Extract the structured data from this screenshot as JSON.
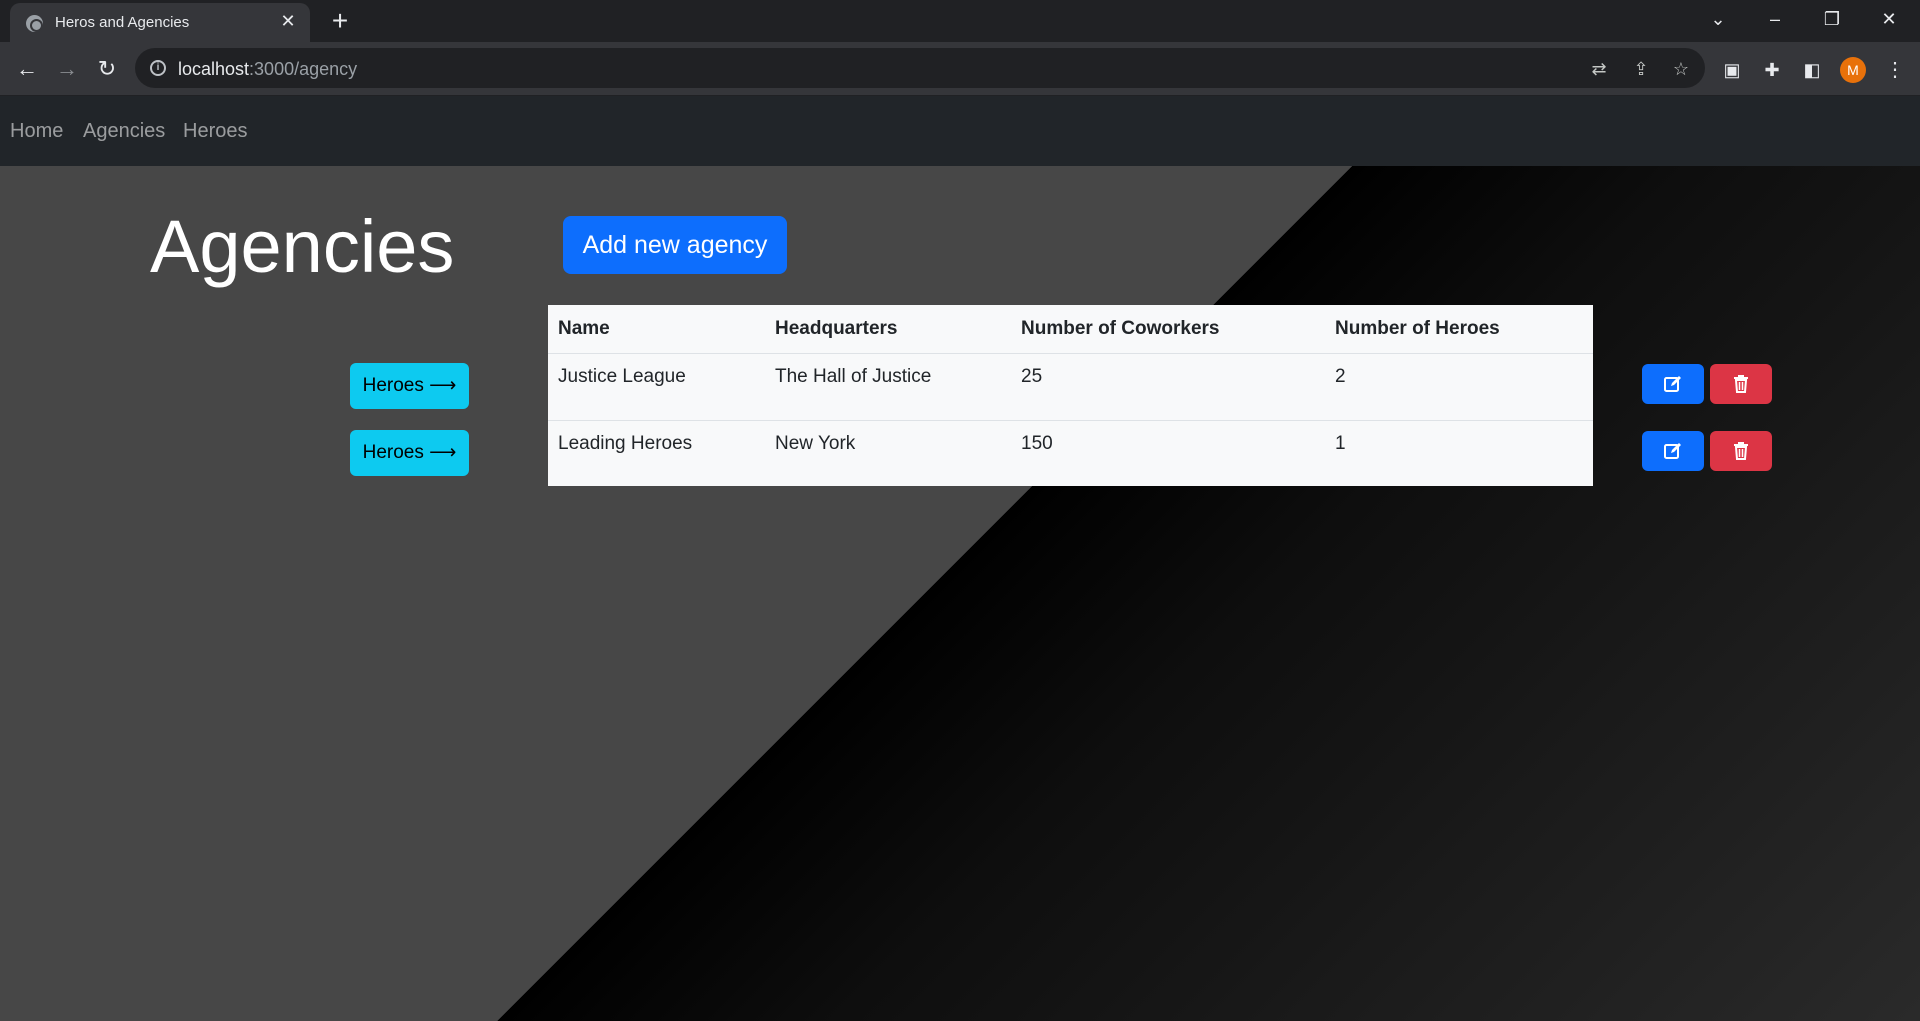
{
  "browser": {
    "tab_title": "Heros and Agencies",
    "url_host": "localhost",
    "url_path": ":3000/agency",
    "profile_initial": "M"
  },
  "nav": {
    "links": [
      "Home",
      "Agencies",
      "Heroes"
    ]
  },
  "page": {
    "title": "Agencies",
    "add_button": "Add new agency"
  },
  "table": {
    "headers": [
      "Name",
      "Headquarters",
      "Number of Coworkers",
      "Number of Heroes"
    ],
    "rows": [
      [
        "Justice League",
        "The Hall of Justice",
        "25",
        "2"
      ],
      [
        "Leading Heroes",
        "New York",
        "150",
        "1"
      ]
    ]
  },
  "row_actions": {
    "heroes_label": "Heroes ⟶"
  },
  "colors": {
    "primary": "#0d6efd",
    "info": "#0dcaf0",
    "danger": "#dc3545",
    "navbar": "#212529"
  }
}
